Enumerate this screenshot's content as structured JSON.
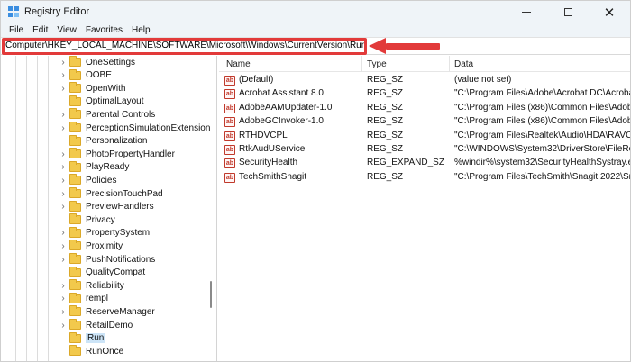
{
  "window": {
    "title": "Registry Editor",
    "controls": {
      "close_glyph": "✕"
    }
  },
  "menu": [
    "File",
    "Edit",
    "View",
    "Favorites",
    "Help"
  ],
  "address": {
    "path": "Computer\\HKEY_LOCAL_MACHINE\\SOFTWARE\\Microsoft\\Windows\\CurrentVersion\\Run"
  },
  "tree": {
    "items": [
      {
        "label": "OneSettings",
        "expandable": true,
        "selected": false
      },
      {
        "label": "OOBE",
        "expandable": true,
        "selected": false
      },
      {
        "label": "OpenWith",
        "expandable": true,
        "selected": false
      },
      {
        "label": "OptimalLayout",
        "expandable": false,
        "selected": false
      },
      {
        "label": "Parental Controls",
        "expandable": true,
        "selected": false
      },
      {
        "label": "PerceptionSimulationExtension",
        "expandable": true,
        "selected": false
      },
      {
        "label": "Personalization",
        "expandable": false,
        "selected": false
      },
      {
        "label": "PhotoPropertyHandler",
        "expandable": true,
        "selected": false
      },
      {
        "label": "PlayReady",
        "expandable": true,
        "selected": false
      },
      {
        "label": "Policies",
        "expandable": true,
        "selected": false
      },
      {
        "label": "PrecisionTouchPad",
        "expandable": true,
        "selected": false
      },
      {
        "label": "PreviewHandlers",
        "expandable": true,
        "selected": false
      },
      {
        "label": "Privacy",
        "expandable": false,
        "selected": false
      },
      {
        "label": "PropertySystem",
        "expandable": true,
        "selected": false
      },
      {
        "label": "Proximity",
        "expandable": true,
        "selected": false
      },
      {
        "label": "PushNotifications",
        "expandable": true,
        "selected": false
      },
      {
        "label": "QualityCompat",
        "expandable": false,
        "selected": false
      },
      {
        "label": "Reliability",
        "expandable": true,
        "selected": false
      },
      {
        "label": "rempl",
        "expandable": true,
        "selected": false
      },
      {
        "label": "ReserveManager",
        "expandable": true,
        "selected": false
      },
      {
        "label": "RetailDemo",
        "expandable": true,
        "selected": false
      },
      {
        "label": "Run",
        "expandable": false,
        "selected": true
      },
      {
        "label": "RunOnce",
        "expandable": false,
        "selected": false
      }
    ]
  },
  "list": {
    "columns": [
      "Name",
      "Type",
      "Data"
    ],
    "rows": [
      {
        "name": "(Default)",
        "type": "REG_SZ",
        "data": "(value not set)"
      },
      {
        "name": "Acrobat Assistant 8.0",
        "type": "REG_SZ",
        "data": "\"C:\\Program Files\\Adobe\\Acrobat DC\\Acrobat"
      },
      {
        "name": "AdobeAAMUpdater-1.0",
        "type": "REG_SZ",
        "data": "\"C:\\Program Files (x86)\\Common Files\\Adobe"
      },
      {
        "name": "AdobeGCInvoker-1.0",
        "type": "REG_SZ",
        "data": "\"C:\\Program Files (x86)\\Common Files\\Adobe"
      },
      {
        "name": "RTHDVCPL",
        "type": "REG_SZ",
        "data": "\"C:\\Program Files\\Realtek\\Audio\\HDA\\RAVCp"
      },
      {
        "name": "RtkAudUService",
        "type": "REG_SZ",
        "data": "\"C:\\WINDOWS\\System32\\DriverStore\\FileRep"
      },
      {
        "name": "SecurityHealth",
        "type": "REG_EXPAND_SZ",
        "data": "%windir%\\system32\\SecurityHealthSystray.exe"
      },
      {
        "name": "TechSmithSnagit",
        "type": "REG_SZ",
        "data": "\"C:\\Program Files\\TechSmith\\Snagit 2022\\Sna"
      }
    ]
  },
  "colors": {
    "annotation": "#e23a3a",
    "selection": "#cce4f7",
    "chrome": "#eff4f8",
    "folder": "#f2c94c"
  }
}
